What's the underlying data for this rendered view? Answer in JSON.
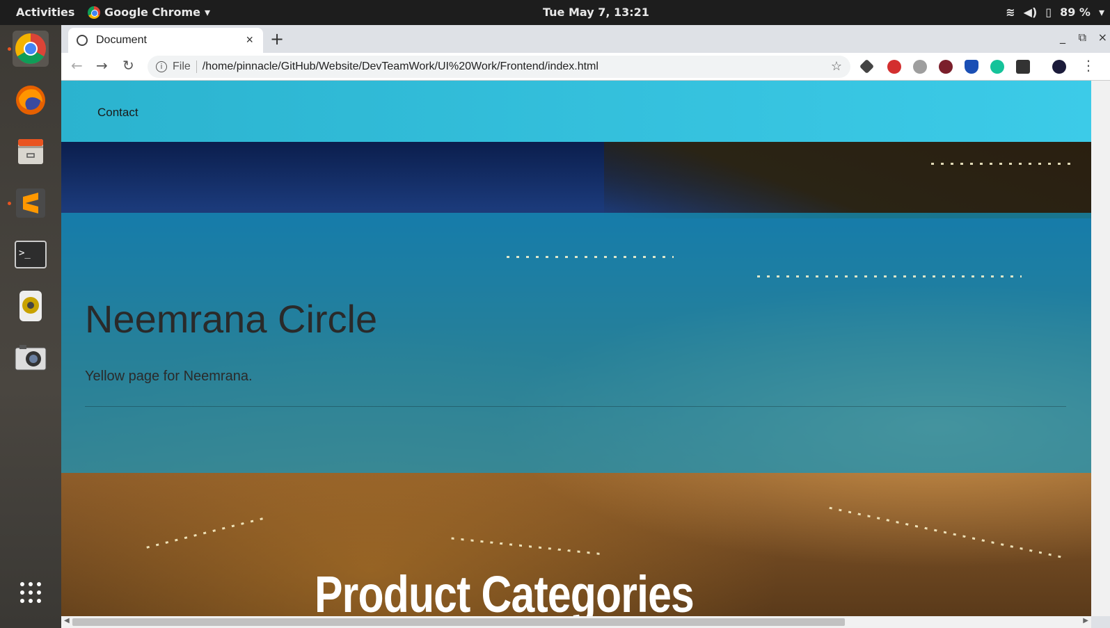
{
  "topbar": {
    "activities": "Activities",
    "app_name": "Google Chrome",
    "app_menu_icon": "chevron-down-icon",
    "clock": "Tue May  7, 13:21",
    "battery": "89 %"
  },
  "dock": {
    "items": [
      "chrome-icon",
      "firefox-icon",
      "files-icon",
      "sublime-text-icon",
      "terminal-icon",
      "speaker-icon",
      "camera-icon",
      "app-grid-icon"
    ]
  },
  "browser": {
    "tab_title": "Document",
    "tab_close": "×",
    "new_tab": "+",
    "url_scheme": "File",
    "url": "/home/pinnacle/GitHub/Website/DevTeamWork/UI%20Work/Frontend/index.html",
    "window_controls": [
      "_",
      "⧉",
      "×"
    ],
    "extensions": [
      {
        "name": "layers-extension-icon",
        "color": "#444444"
      },
      {
        "name": "adblock-plus-icon",
        "color": "#d32f2f"
      },
      {
        "name": "cloud-extension-icon",
        "color": "#9e9e9e"
      },
      {
        "name": "k-extension-icon",
        "color": "#7b1f2b"
      },
      {
        "name": "shield-extension-icon",
        "color": "#1a4fb5"
      },
      {
        "name": "grammarly-icon",
        "color": "#15c39a"
      },
      {
        "name": "vault-extension-icon",
        "color": "#333333"
      },
      {
        "name": "profile-avatar-icon",
        "color": "#1b1b3a"
      }
    ]
  },
  "page": {
    "nav_link": "Contact",
    "jumbotron_title": "Neemrana Circle",
    "jumbotron_text": "Yellow page for Neemrana.",
    "section_title": "Product Categories",
    "navbar_color": "#2bb3cf"
  }
}
